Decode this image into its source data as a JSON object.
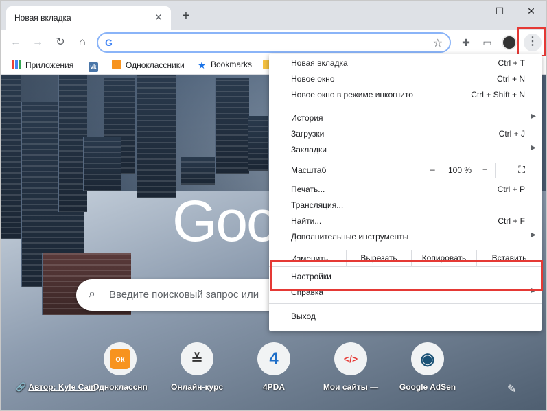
{
  "tab": {
    "title": "Новая вкладка",
    "close": "✕"
  },
  "newtab": "+",
  "window_controls": {
    "minimize": "—",
    "maximize": "☐",
    "close": "✕"
  },
  "nav": {
    "back": "←",
    "forward": "→",
    "reload": "↻",
    "home": "⌂"
  },
  "omnibox": {
    "value": "",
    "g": "G",
    "star": "☆"
  },
  "toolbar_icons": {
    "extensions": "✚",
    "cast": "▭",
    "menu": "⋮"
  },
  "bookmarks": [
    {
      "label": "Приложения",
      "color": "#4285f4"
    },
    {
      "label": "",
      "color": "#4a76a8",
      "badge": "vk"
    },
    {
      "label": "Одноклассники",
      "color": "#f7931e"
    },
    {
      "label": "Bookmarks",
      "color": "#1a73e8",
      "badge": "★"
    }
  ],
  "newtab_page": {
    "logo": "Goo",
    "search_placeholder": "Введите поисковый запрос или",
    "author_prefix": "Автор:",
    "author_name": "Kyle Cain",
    "shortcuts": [
      {
        "label": "Однокласснп",
        "icon": "ок",
        "color": "#f7931e"
      },
      {
        "label": "Онлайн-курс",
        "icon": "≚",
        "color": "#333333"
      },
      {
        "label": "4PDA",
        "icon": "4",
        "color": "#1e6ec8"
      },
      {
        "label": "Мои сайты —",
        "icon": "</>",
        "color": "#e53935"
      },
      {
        "label": "Google AdSen",
        "icon": "◉",
        "color": "#1a5276"
      }
    ]
  },
  "menu": {
    "new_tab": {
      "label": "Новая вкладка",
      "shortcut": "Ctrl + T"
    },
    "new_window": {
      "label": "Новое окно",
      "shortcut": "Ctrl + N"
    },
    "incognito": {
      "label": "Новое окно в режиме инкогнито",
      "shortcut": "Ctrl + Shift + N"
    },
    "history": {
      "label": "История"
    },
    "downloads": {
      "label": "Загрузки",
      "shortcut": "Ctrl + J"
    },
    "bookmarks": {
      "label": "Закладки"
    },
    "zoom": {
      "label": "Масштаб",
      "minus": "–",
      "value": "100 %",
      "plus": "+",
      "fullscreen": "⛶"
    },
    "print": {
      "label": "Печать...",
      "shortcut": "Ctrl + P"
    },
    "cast": {
      "label": "Трансляция..."
    },
    "find": {
      "label": "Найти...",
      "shortcut": "Ctrl + F"
    },
    "more_tools": {
      "label": "Дополнительные инструменты"
    },
    "edit": {
      "label": "Изменить",
      "cut": "Вырезать",
      "copy": "Копировать",
      "paste": "Вставить"
    },
    "settings": {
      "label": "Настройки"
    },
    "help": {
      "label": "Справка"
    },
    "exit": {
      "label": "Выход"
    },
    "submenu_arrow": "▶"
  }
}
